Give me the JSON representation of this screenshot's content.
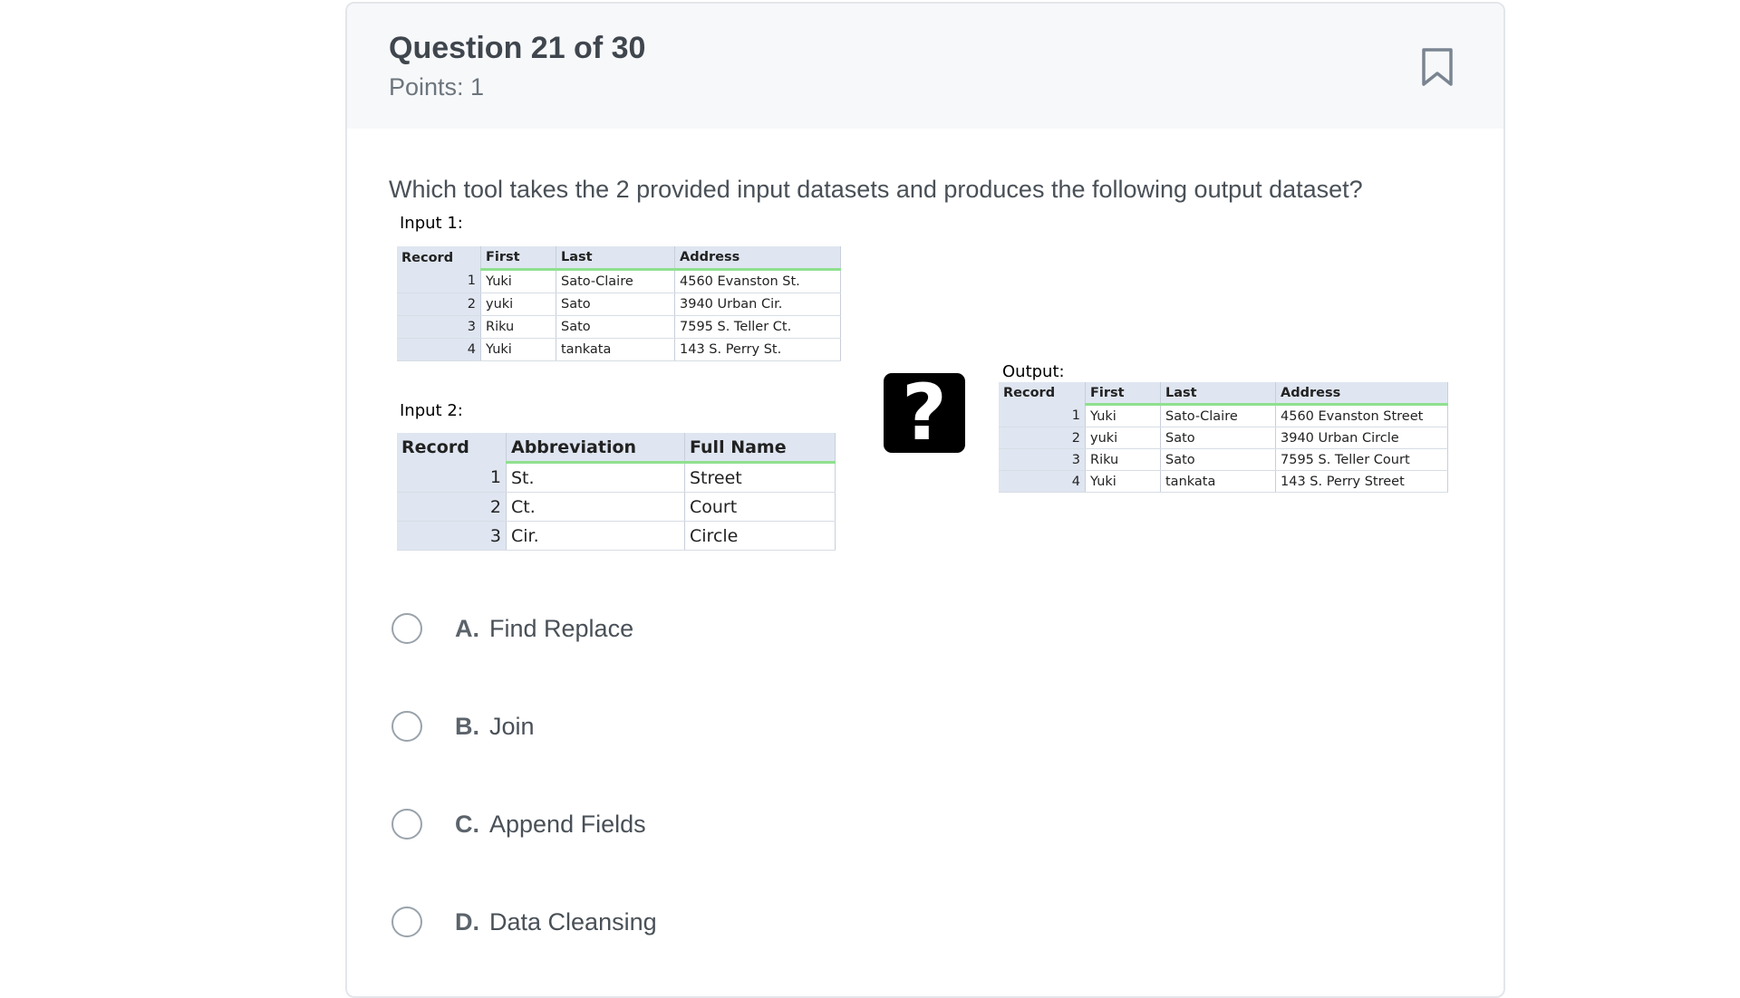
{
  "question": {
    "title": "Question 21 of 30",
    "points": "Points: 1",
    "text": "Which tool takes the 2 provided input datasets and produces the following output dataset?"
  },
  "figure": {
    "input1": {
      "label": "Input 1:",
      "headers": [
        "Record",
        "First",
        "Last",
        "Address"
      ],
      "rows": [
        [
          "1",
          "Yuki",
          "Sato-Claire",
          "4560 Evanston St."
        ],
        [
          "2",
          "yuki",
          "Sato",
          "3940 Urban Cir."
        ],
        [
          "3",
          "Riku",
          "Sato",
          "7595 S. Teller Ct."
        ],
        [
          "4",
          "Yuki",
          "tankata",
          "143 S. Perry St."
        ]
      ]
    },
    "input2": {
      "label": "Input 2:",
      "headers": [
        "Record",
        "Abbreviation",
        "Full Name"
      ],
      "rows": [
        [
          "1",
          "St.",
          "Street"
        ],
        [
          "2",
          "Ct.",
          "Court"
        ],
        [
          "3",
          "Cir.",
          "Circle"
        ]
      ]
    },
    "question_mark": "?",
    "output": {
      "label": "Output:",
      "headers": [
        "Record",
        "First",
        "Last",
        "Address"
      ],
      "rows": [
        [
          "1",
          "Yuki",
          "Sato-Claire",
          "4560 Evanston Street"
        ],
        [
          "2",
          "yuki",
          "Sato",
          "3940 Urban Circle"
        ],
        [
          "3",
          "Riku",
          "Sato",
          "7595 S. Teller Court"
        ],
        [
          "4",
          "Yuki",
          "tankata",
          "143 S. Perry Street"
        ]
      ]
    }
  },
  "options": [
    {
      "letter": "A.",
      "text": "Find Replace"
    },
    {
      "letter": "B.",
      "text": "Join"
    },
    {
      "letter": "C.",
      "text": "Append Fields"
    },
    {
      "letter": "D.",
      "text": "Data Cleansing"
    }
  ],
  "icons": {
    "bookmark": "bookmark-icon"
  }
}
